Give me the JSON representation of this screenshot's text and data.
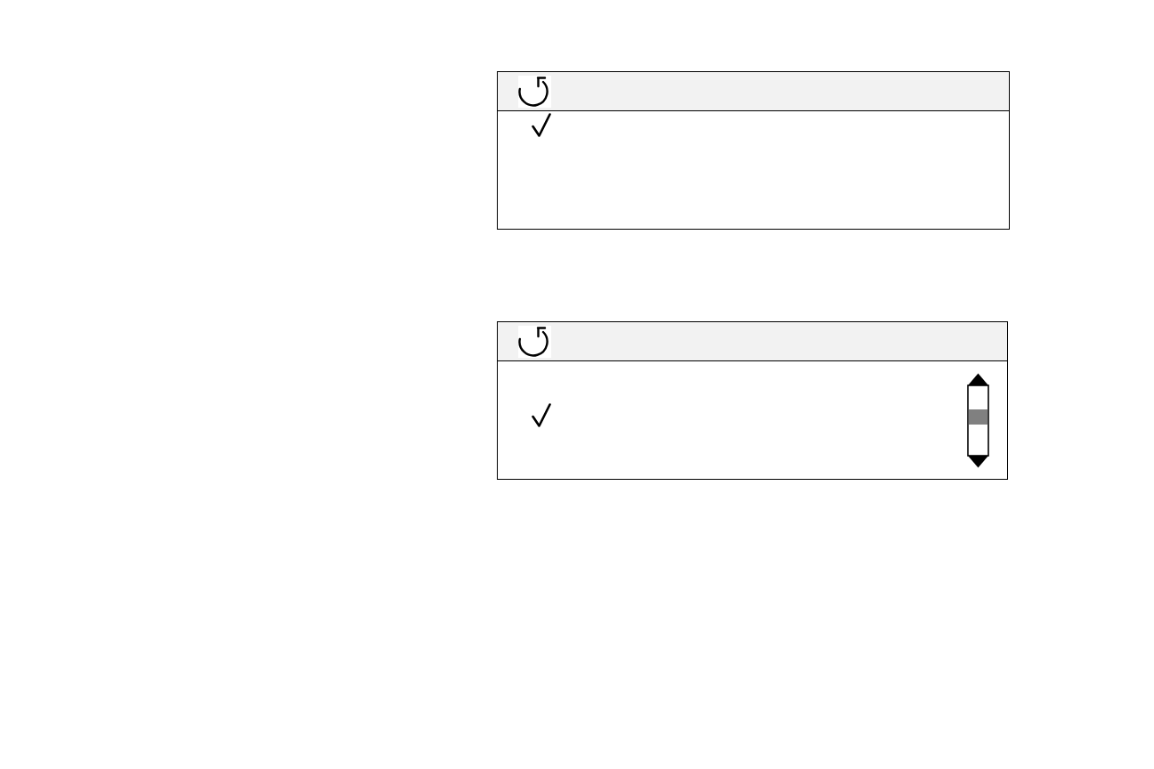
{
  "panels": [
    {
      "rows": [
        {
          "checked": true
        },
        {
          "checked": false
        },
        {
          "checked": false
        }
      ],
      "scrollbar": false
    },
    {
      "rows": [
        {
          "checked": false
        },
        {
          "checked": true
        },
        {
          "checked": false
        }
      ],
      "scrollbar": true
    }
  ]
}
